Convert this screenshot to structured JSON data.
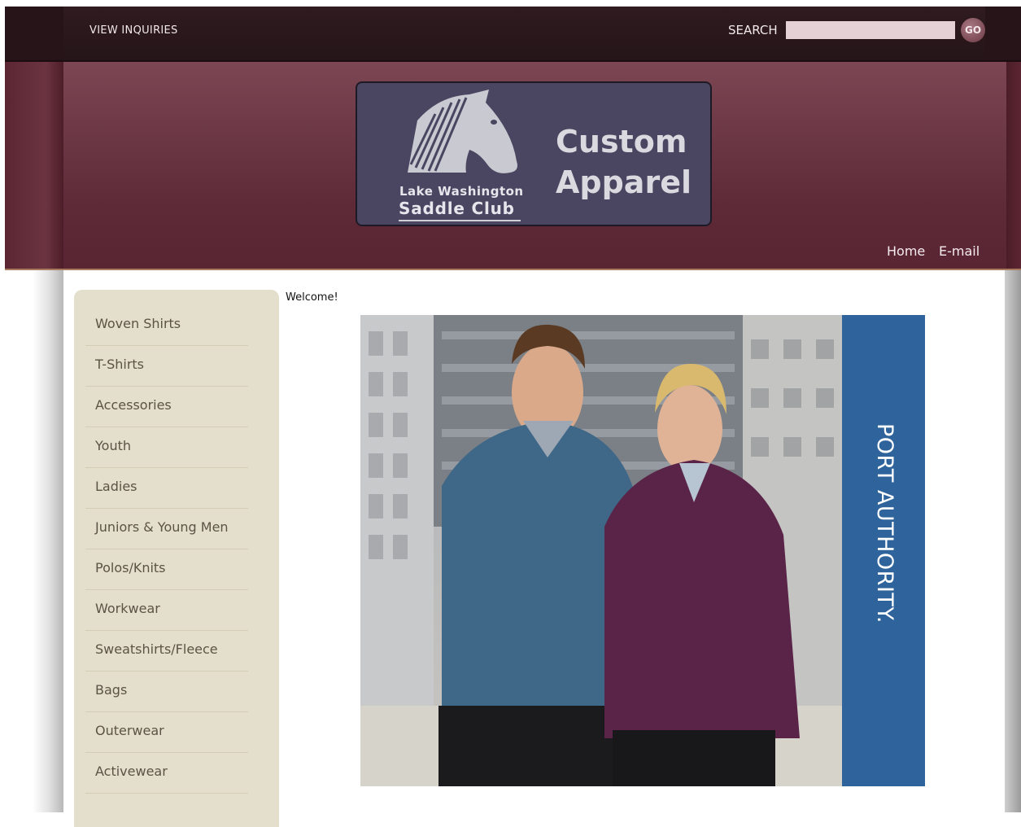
{
  "topbar": {
    "view_inquiries": "VIEW INQUIRIES",
    "search_label": "SEARCH",
    "search_value": "",
    "go_label": "GO"
  },
  "header": {
    "logo": {
      "club_line1": "Lake Washington",
      "club_line2": "Saddle Club",
      "title_line1": "Custom",
      "title_line2": "Apparel"
    },
    "nav": {
      "home": "Home",
      "email": "E-mail"
    }
  },
  "sidebar": {
    "items": [
      {
        "label": "Woven Shirts"
      },
      {
        "label": "T-Shirts"
      },
      {
        "label": "Accessories"
      },
      {
        "label": "Youth"
      },
      {
        "label": "Ladies"
      },
      {
        "label": "Juniors & Young Men"
      },
      {
        "label": "Polos/Knits"
      },
      {
        "label": "Workwear"
      },
      {
        "label": "Sweatshirts/Fleece"
      },
      {
        "label": "Bags"
      },
      {
        "label": "Outerwear"
      },
      {
        "label": "Activewear"
      }
    ]
  },
  "main": {
    "welcome": "Welcome!",
    "banner": {
      "brand": "PORT AUTHORITY."
    }
  },
  "colors": {
    "header_maroon": "#6a3340",
    "topbar": "#2b171c",
    "sidebar_bg": "#e4dfcc",
    "brand_blue": "#2e639b"
  }
}
